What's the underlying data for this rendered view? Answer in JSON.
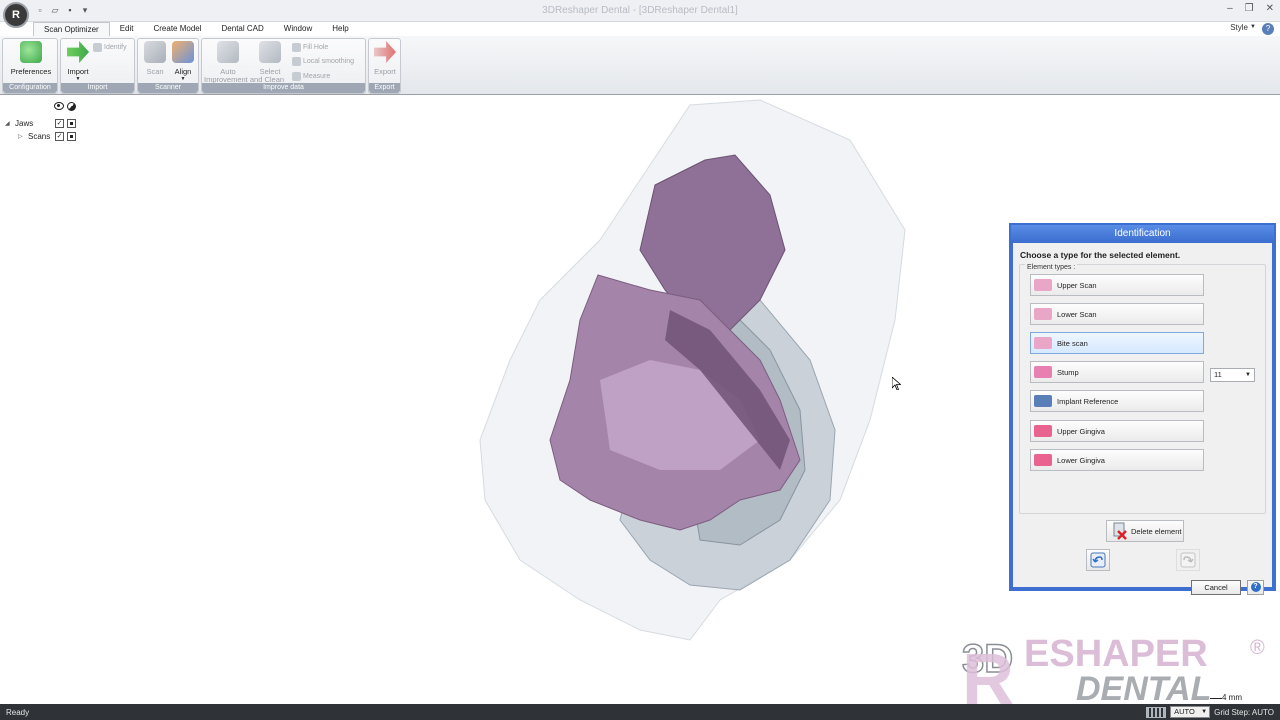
{
  "window": {
    "title": "3DReshaper Dental - [3DReshaper Dental1]",
    "style_label": "Style"
  },
  "menu_tabs": [
    "Scan Optimizer",
    "Edit",
    "Create Model",
    "Dental CAD",
    "Window",
    "Help"
  ],
  "ribbon": {
    "configuration": {
      "label": "Configuration",
      "preferences": "Preferences"
    },
    "import": {
      "label": "Import",
      "import_button": "Import",
      "identify": "Identify"
    },
    "scanner": {
      "label": "Scanner",
      "scan": "Scan",
      "align": "Align"
    },
    "improve_data": {
      "label": "Improve data",
      "auto_improvement": "Auto Improvement",
      "select_and_clean": "Select and Clean",
      "select_top": "Select",
      "auto_top": "Auto",
      "improvement_and_clean": "Improvement and Clean",
      "fill_hole": "Fill Hole",
      "local_smoothing": "Local smoothing",
      "measure": "Measure"
    },
    "export": {
      "label": "Export",
      "export_button": "Export"
    }
  },
  "tree": {
    "root": "Jaws",
    "child": "Scans"
  },
  "dialog": {
    "title": "Identification",
    "prompt": "Choose a type for the selected element.",
    "group_label": "Element types :",
    "element_types": [
      {
        "label": "Upper Scan",
        "color": "#e9a6c6"
      },
      {
        "label": "Lower Scan",
        "color": "#e9a6c6"
      },
      {
        "label": "Bite scan",
        "color": "#e9a6c6"
      },
      {
        "label": "Stump",
        "color": "#e77fb0"
      },
      {
        "label": "Implant Reference",
        "color": "#5a7fb8"
      },
      {
        "label": "Upper Gingiva",
        "color": "#e8638f"
      },
      {
        "label": "Lower Gingiva",
        "color": "#e8638f"
      }
    ],
    "selected_index": 2,
    "stump_number": "11",
    "delete_button": "Delete element",
    "cancel_button": "Cancel",
    "help_glyph": "?"
  },
  "watermark": {
    "line1": "3D RESHAPER",
    "registered": "®",
    "line2": "DENTAL"
  },
  "scale_text": "4 mm",
  "statusbar": {
    "status": "Ready",
    "grid_mode": "AUTO",
    "grid_step": "Grid Step: AUTO"
  },
  "colors": {
    "accent": "#3c6fd0",
    "model_purple": "#9b7aa3",
    "model_gray": "#b9c4cc",
    "statusbar": "#2f3338"
  }
}
